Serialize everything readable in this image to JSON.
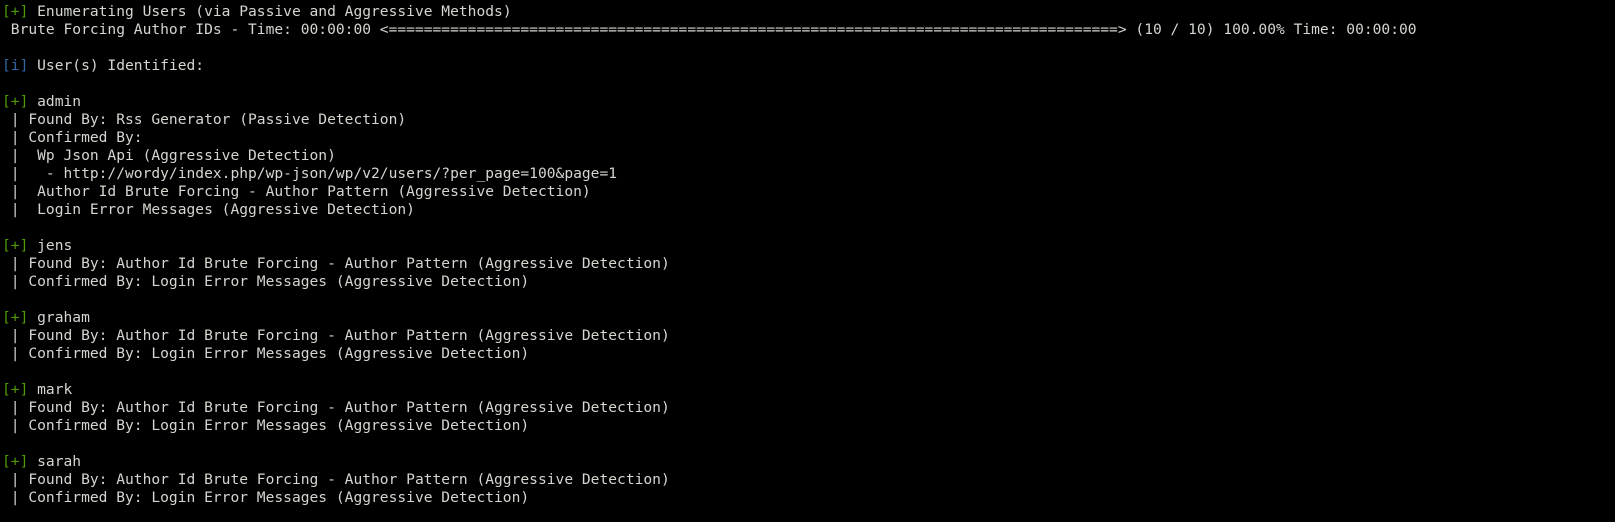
{
  "colors": {
    "background": "#000000",
    "text": "#d3d7cf",
    "plus_marker": "#4e9a06",
    "info_marker": "#3465a4"
  },
  "markers": {
    "plus": "[+]",
    "info": "[i]"
  },
  "header": {
    "enumerating": " Enumerating Users (via Passive and Aggressive Methods)",
    "progress": " Brute Forcing Author IDs - Time: 00:00:00 <===================================================================================> (10 / 10) 100.00% Time: 00:00:00",
    "identified": " User(s) Identified:"
  },
  "users": [
    {
      "name": " admin",
      "details": [
        " | Found By: Rss Generator (Passive Detection)",
        " | Confirmed By:",
        " |  Wp Json Api (Aggressive Detection)",
        " |   - http://wordy/index.php/wp-json/wp/v2/users/?per_page=100&page=1",
        " |  Author Id Brute Forcing - Author Pattern (Aggressive Detection)",
        " |  Login Error Messages (Aggressive Detection)"
      ]
    },
    {
      "name": " jens",
      "details": [
        " | Found By: Author Id Brute Forcing - Author Pattern (Aggressive Detection)",
        " | Confirmed By: Login Error Messages (Aggressive Detection)"
      ]
    },
    {
      "name": " graham",
      "details": [
        " | Found By: Author Id Brute Forcing - Author Pattern (Aggressive Detection)",
        " | Confirmed By: Login Error Messages (Aggressive Detection)"
      ]
    },
    {
      "name": " mark",
      "details": [
        " | Found By: Author Id Brute Forcing - Author Pattern (Aggressive Detection)",
        " | Confirmed By: Login Error Messages (Aggressive Detection)"
      ]
    },
    {
      "name": " sarah",
      "details": [
        " | Found By: Author Id Brute Forcing - Author Pattern (Aggressive Detection)",
        " | Confirmed By: Login Error Messages (Aggressive Detection)"
      ]
    }
  ]
}
